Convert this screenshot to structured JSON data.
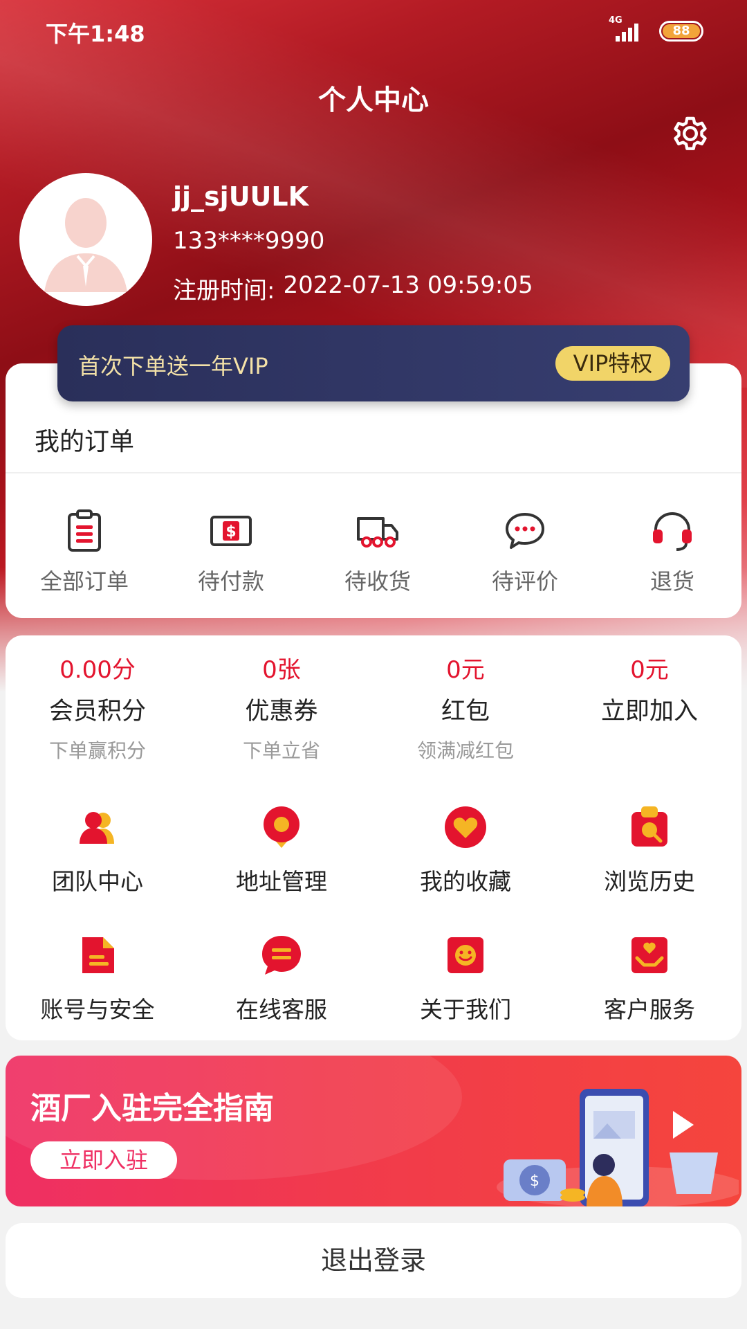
{
  "status_bar": {
    "time": "下午1:48",
    "network": "4G",
    "battery": "88"
  },
  "header": {
    "title": "个人中心"
  },
  "profile": {
    "username": "jj_sjUULK",
    "phone": "133****9990",
    "reg_label": "注册时间:",
    "reg_time": "2022-07-13 09:59:05"
  },
  "vip": {
    "text": "首次下单送一年VIP",
    "button": "VIP特权"
  },
  "orders": {
    "title": "我的订单",
    "items": [
      {
        "label": "全部订单",
        "icon": "clipboard-icon"
      },
      {
        "label": "待付款",
        "icon": "payment-icon"
      },
      {
        "label": "待收货",
        "icon": "truck-icon"
      },
      {
        "label": "待评价",
        "icon": "comment-icon"
      },
      {
        "label": "退货",
        "icon": "headset-icon"
      }
    ]
  },
  "stats": [
    {
      "value": "0.00分",
      "label": "会员积分",
      "sub": "下单赢积分"
    },
    {
      "value": "0张",
      "label": "优惠券",
      "sub": "下单立省"
    },
    {
      "value": "0元",
      "label": "红包",
      "sub": "领满减红包"
    },
    {
      "value": "0元",
      "label": "立即加入",
      "sub": ""
    }
  ],
  "menu": [
    {
      "label": "团队中心",
      "icon": "team-icon"
    },
    {
      "label": "地址管理",
      "icon": "location-icon"
    },
    {
      "label": "我的收藏",
      "icon": "heart-icon"
    },
    {
      "label": "浏览历史",
      "icon": "history-icon"
    },
    {
      "label": "账号与安全",
      "icon": "document-icon"
    },
    {
      "label": "在线客服",
      "icon": "chat-icon"
    },
    {
      "label": "关于我们",
      "icon": "smile-icon"
    },
    {
      "label": "客户服务",
      "icon": "service-icon"
    }
  ],
  "promo": {
    "title": "酒厂入驻完全指南",
    "button": "立即入驻"
  },
  "logout": {
    "label": "退出登录"
  },
  "colors": {
    "accent": "#e3142e",
    "header": "#b31b24",
    "vip_bg": "#2f355f",
    "vip_button": "#f1d468"
  }
}
